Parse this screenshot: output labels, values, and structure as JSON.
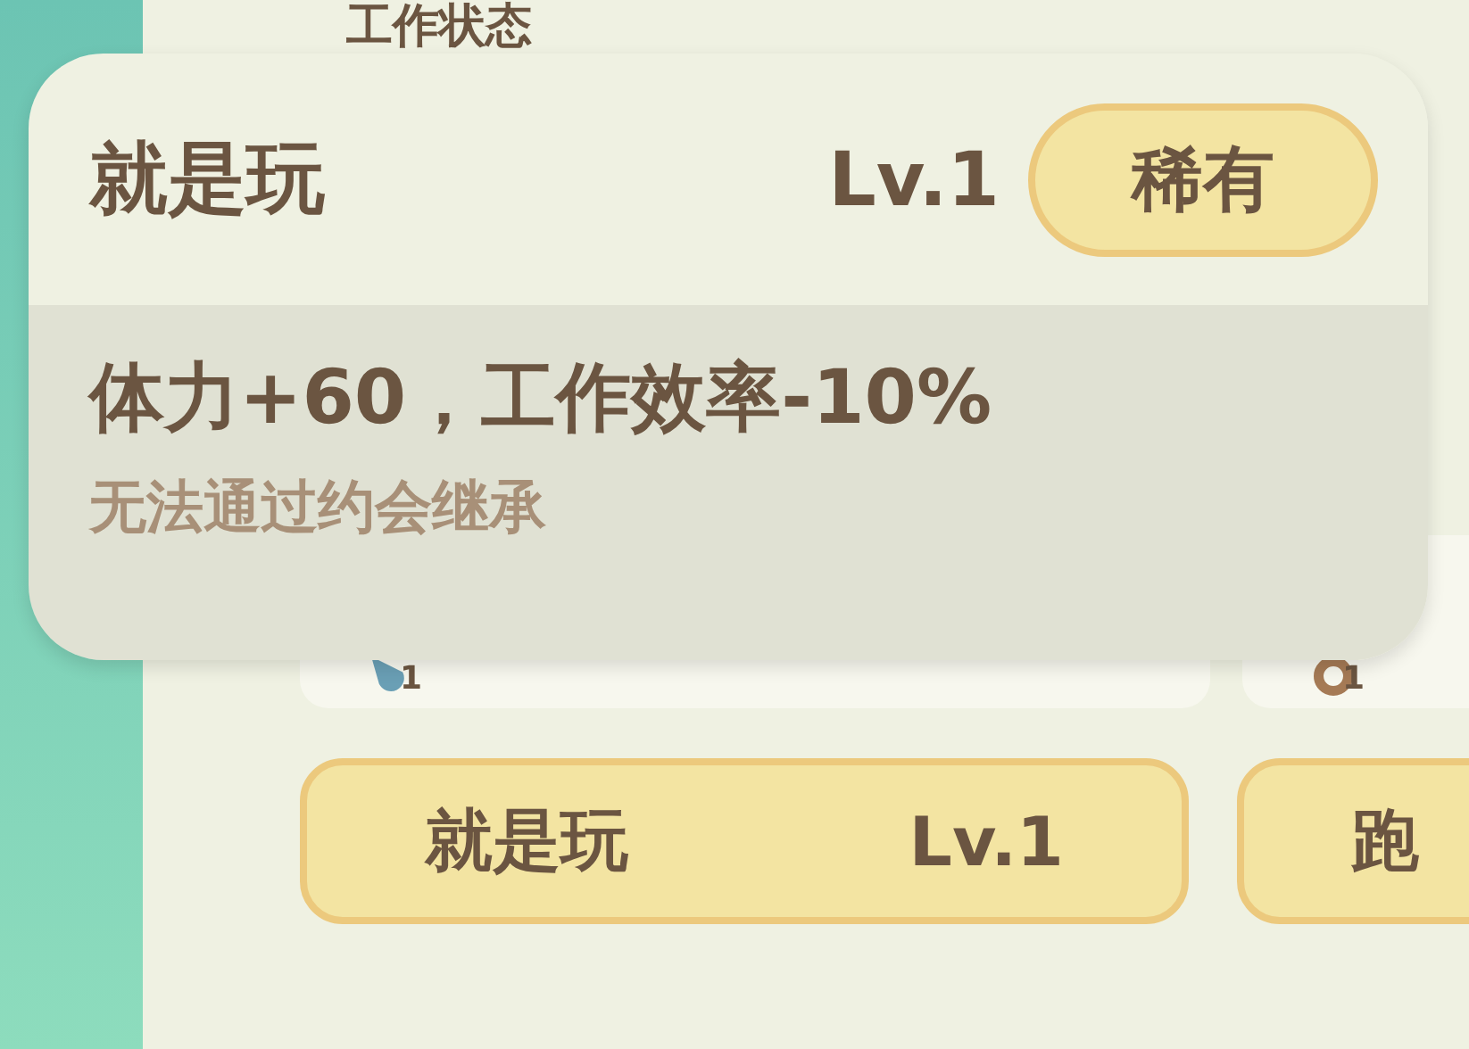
{
  "section_title": "工作状态",
  "items": [
    {
      "kind": "drop",
      "count": "1"
    },
    {
      "kind": "paw",
      "count": "1"
    }
  ],
  "traits": [
    {
      "name": "就是玩",
      "level": "Lv.1"
    },
    {
      "name": "跑"
    }
  ],
  "tooltip": {
    "name": "就是玩",
    "level": "Lv.1",
    "rarity": "稀有",
    "effect": "体力+60，工作效率-10%",
    "note": "无法通过约会继承"
  }
}
